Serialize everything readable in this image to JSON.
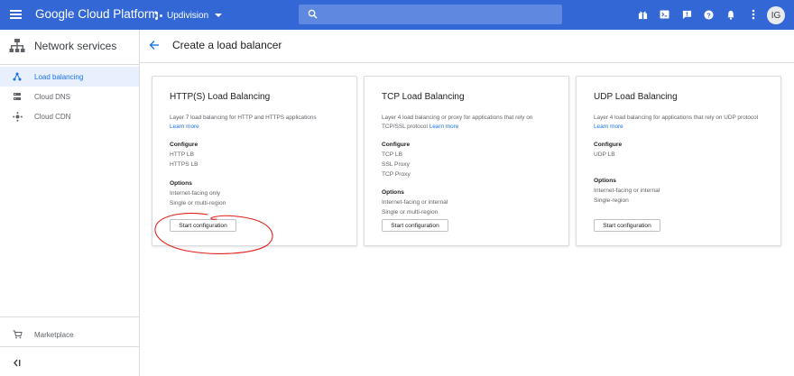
{
  "topbar": {
    "title": "Google Cloud Platform",
    "project": "Updivision",
    "icons": [
      "gift-icon",
      "cloud-shell-icon",
      "feedback-icon",
      "help-icon",
      "notifications-icon",
      "more-vert-icon"
    ],
    "avatar_initials": "IG",
    "color": "#3367d6"
  },
  "sidebar": {
    "title": "Network services",
    "items": [
      {
        "label": "Load balancing",
        "icon": "load-balancing-icon",
        "active": true
      },
      {
        "label": "Cloud DNS",
        "icon": "dns-icon",
        "active": false
      },
      {
        "label": "Cloud CDN",
        "icon": "cdn-icon",
        "active": false
      }
    ],
    "marketplace": "Marketplace",
    "collapse_label": "<|"
  },
  "page": {
    "title": "Create a load balancer"
  },
  "cards": [
    {
      "title": "HTTP(S) Load Balancing",
      "desc": "Layer 7 load balancing for HTTP and HTTPS applications",
      "learn": "Learn more",
      "configure_h": "Configure",
      "configure": [
        "HTTP LB",
        "HTTPS LB"
      ],
      "options_h": "Options",
      "options": [
        "Internet-facing only",
        "Single or multi-region"
      ],
      "button": "Start configuration"
    },
    {
      "title": "TCP Load Balancing",
      "desc": "Layer 4 load balancing or proxy for applications that rely on TCP/SSL protocol",
      "learn": "Learn more",
      "configure_h": "Configure",
      "configure": [
        "TCP LB",
        "SSL Proxy",
        "TCP Proxy"
      ],
      "options_h": "Options",
      "options": [
        "Internet-facing or internal",
        "Single or multi-region"
      ],
      "button": "Start configuration"
    },
    {
      "title": "UDP Load Balancing",
      "desc": "Layer 4 load balancing for applications that rely on UDP protocol",
      "learn": "Learn more",
      "configure_h": "Configure",
      "configure": [
        "UDP LB"
      ],
      "options_h": "Options",
      "options": [
        "Internet-facing or internal",
        "Single-region"
      ],
      "button": "Start configuration"
    }
  ],
  "colors": {
    "accent": "#1a73e8",
    "annotation": "#e0201b"
  }
}
